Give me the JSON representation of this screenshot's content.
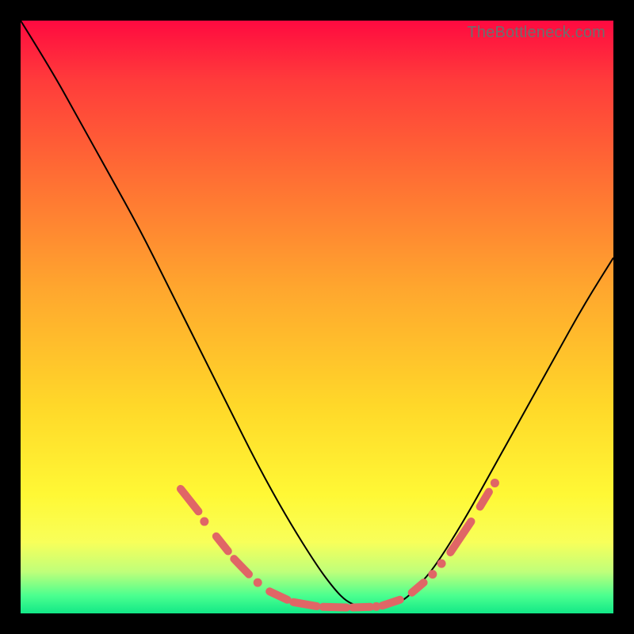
{
  "watermark": "TheBottleneck.com",
  "colors": {
    "background_frame": "#000000",
    "curve_stroke": "#000000",
    "marker": "#e06666",
    "gradient_top": "#ff0a40",
    "gradient_bottom": "#12e887"
  },
  "chart_data": {
    "type": "line",
    "title": "",
    "xlabel": "",
    "ylabel": "",
    "xlim": [
      0,
      100
    ],
    "ylim": [
      0,
      100
    ],
    "grid": false,
    "legend": false,
    "series": [
      {
        "name": "bottleneck-curve",
        "x": [
          0,
          5,
          10,
          15,
          20,
          25,
          30,
          35,
          40,
          45,
          50,
          53,
          55,
          57,
          60,
          63,
          65,
          67,
          70,
          75,
          80,
          85,
          90,
          95,
          100
        ],
        "y": [
          100,
          92,
          83,
          74,
          65,
          55,
          45,
          35,
          25,
          16,
          8,
          4,
          2,
          1.2,
          1,
          1.4,
          2.5,
          4.5,
          8,
          16,
          25,
          34,
          43,
          52,
          60
        ]
      }
    ],
    "markers": [
      {
        "x1": 27,
        "y1": 21,
        "x2": 30,
        "y2": 17.2,
        "type": "dash"
      },
      {
        "x": 31,
        "y": 15.5,
        "type": "dot"
      },
      {
        "x1": 33,
        "y1": 13,
        "x2": 35,
        "y2": 10.5,
        "type": "dash"
      },
      {
        "x1": 36,
        "y1": 9.2,
        "x2": 38.5,
        "y2": 6.6,
        "type": "dash"
      },
      {
        "x": 40,
        "y": 5.2,
        "type": "dot"
      },
      {
        "x1": 42,
        "y1": 3.7,
        "x2": 45,
        "y2": 2.3,
        "type": "dash"
      },
      {
        "x1": 46,
        "y1": 1.9,
        "x2": 50,
        "y2": 1.2,
        "type": "dash"
      },
      {
        "x1": 51,
        "y1": 1.1,
        "x2": 55,
        "y2": 1.0,
        "type": "dash"
      },
      {
        "x1": 56,
        "y1": 1.0,
        "x2": 59,
        "y2": 1.1,
        "type": "dash"
      },
      {
        "x": 60,
        "y": 1.15,
        "type": "dot"
      },
      {
        "x1": 61,
        "y1": 1.3,
        "x2": 64,
        "y2": 2.3,
        "type": "dash"
      },
      {
        "x1": 66,
        "y1": 3.5,
        "x2": 68,
        "y2": 5.2,
        "type": "dash"
      },
      {
        "x": 69.5,
        "y": 6.6,
        "type": "dot"
      },
      {
        "x": 71,
        "y": 8.4,
        "type": "dot"
      },
      {
        "x1": 72.5,
        "y1": 10.3,
        "x2": 76,
        "y2": 15.5,
        "type": "dash"
      },
      {
        "x1": 77.5,
        "y1": 18,
        "x2": 79,
        "y2": 20.5,
        "type": "dash"
      },
      {
        "x": 80,
        "y": 22,
        "type": "dot"
      }
    ]
  }
}
